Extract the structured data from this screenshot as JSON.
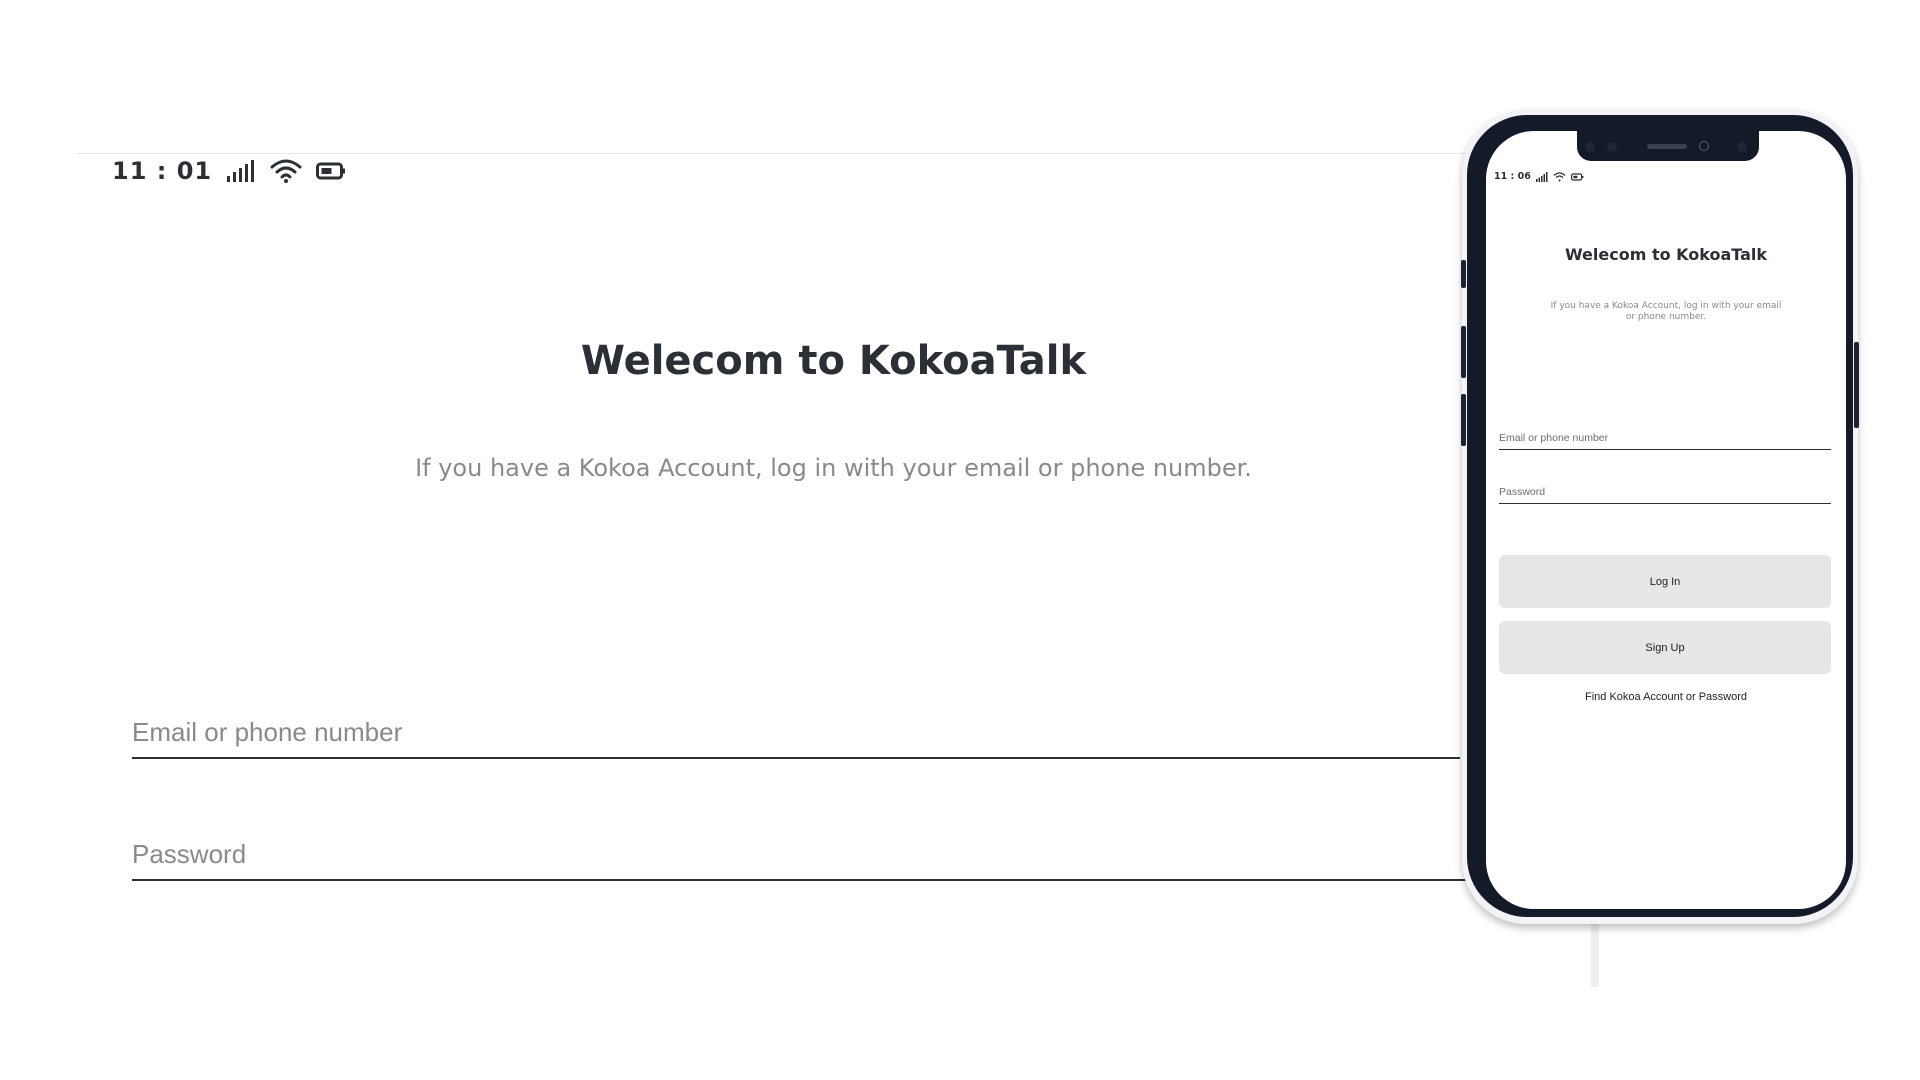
{
  "large_view": {
    "status_bar": {
      "time": "11 : 01",
      "icons": [
        "cellular-signal-icon",
        "wifi-icon",
        "battery-icon"
      ]
    },
    "title": "Welecom to KokoaTalk",
    "subtitle": "If you have a Kokoa Account, log in with your email or phone number.",
    "email_field": {
      "placeholder": "Email or phone number",
      "value": ""
    },
    "password_field": {
      "placeholder": "Password",
      "value": ""
    }
  },
  "phone_view": {
    "status_bar": {
      "time": "11 : 06",
      "icons": [
        "cellular-signal-icon",
        "wifi-icon",
        "battery-icon"
      ]
    },
    "title": "Welecom to KokoaTalk",
    "subtitle": "If you have a Kokoa Account, log in with your email or phone number.",
    "email_field": {
      "placeholder": "Email or phone number",
      "value": ""
    },
    "password_field": {
      "placeholder": "Password",
      "value": ""
    },
    "login_button": "Log In",
    "signup_button": "Sign Up",
    "find_account_link": "Find Kokoa Account or Password"
  },
  "colors": {
    "text_dark": "#2b2f36",
    "text_muted": "#8a8a8a",
    "button_bg": "#e6e6e6",
    "phone_frame": "#141a28"
  }
}
